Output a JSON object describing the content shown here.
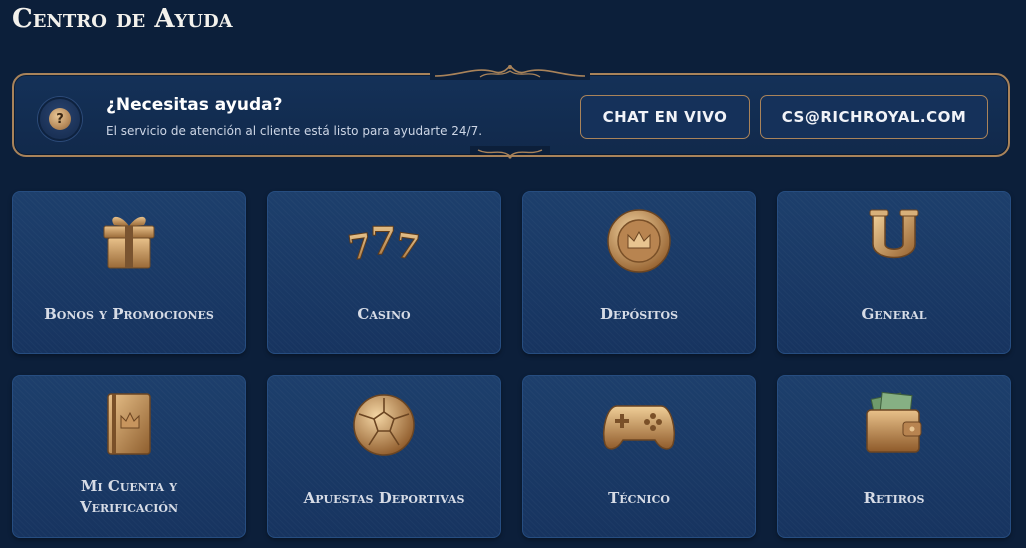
{
  "page_title": "Centro de Ayuda",
  "help_banner": {
    "heading": "¿Necesitas ayuda?",
    "subtitle": "El servicio de atención al cliente está listo para ayudarte 24/7.",
    "icon": "question-mark-icon",
    "icon_glyph": "?",
    "chat_button": "CHAT EN VIVO",
    "email_button": "CS@RICHROYAL.COM"
  },
  "categories": [
    {
      "label": "Bonos y Promociones",
      "icon": "gift-box-icon"
    },
    {
      "label": "Casino",
      "icon": "slot-777-icon"
    },
    {
      "label": "Depósitos",
      "icon": "crown-chip-icon"
    },
    {
      "label": "General",
      "icon": "horseshoe-icon"
    },
    {
      "label": "Mi Cuenta y Verificación",
      "icon": "crown-book-icon"
    },
    {
      "label": "Apuestas Deportivas",
      "icon": "soccer-ball-icon"
    },
    {
      "label": "Técnico",
      "icon": "gamepad-icon"
    },
    {
      "label": "Retiros",
      "icon": "wallet-icon"
    }
  ],
  "colors": {
    "background": "#0c1f3a",
    "card": "#1d3f6c",
    "gold_border": "#a9835a",
    "gold_icon": "#c8965e"
  }
}
